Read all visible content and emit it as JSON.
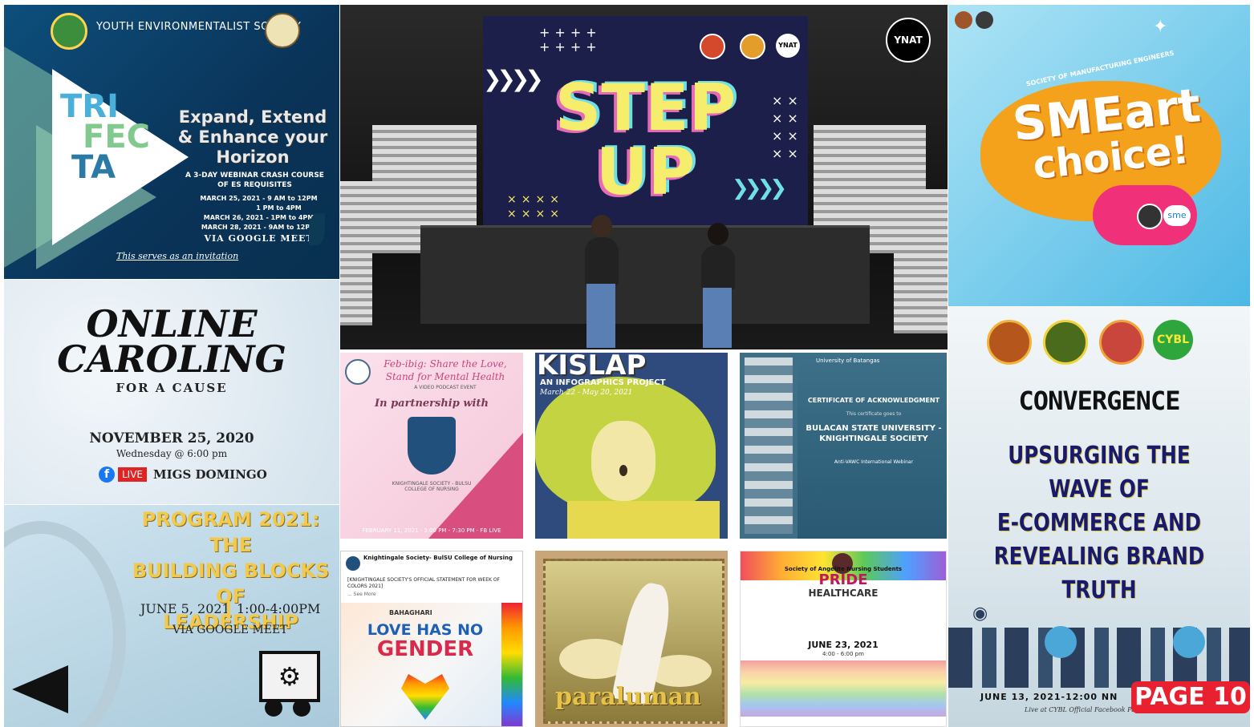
{
  "trifecta": {
    "org": "YOUTH ENVIRONMENTALIST SOCIETY",
    "logo_lines": [
      "TRI",
      "FEC",
      "TA"
    ],
    "headline_1": "Expand, Extend",
    "headline_2": "& Enhance your",
    "headline_3": "Horizon",
    "sub_1": "A 3-DAY WEBINAR CRASH COURSE",
    "sub_2": "OF ES REQUISITES",
    "dates": [
      "MARCH 25, 2021 - 9 AM to 12PM",
      "1 PM to 4PM",
      "MARCH 26, 2021 - 1PM to 4PM",
      "MARCH 28, 2021 - 9AM to 12PM"
    ],
    "via": "VIA GOOGLE MEET",
    "invite": "This serves as an invitation"
  },
  "stepup": {
    "line_1": "STEP",
    "line_2": "UP",
    "badge": "YNAT",
    "corner_badge": "YNAT"
  },
  "smeart": {
    "arc_text": "SOCIETY OF MANUFACTURING ENGINEERS",
    "line_1": "SMEart",
    "line_2": "choice!",
    "badge": "sme"
  },
  "caroling": {
    "line_1": "ONLINE",
    "line_2": "CAROLING",
    "line_3": "FOR A CAUSE",
    "date": "NOVEMBER 25, 2020",
    "time": "Wednesday @ 6:00 pm",
    "live": "LIVE",
    "host": "MIGS DOMINGO"
  },
  "program": {
    "line_1": "PROGRAM 2021: THE",
    "line_2": "BUILDING BLOCKS OF",
    "line_3": "LEADERSHIP",
    "date": "JUNE 5, 2021",
    "time": "1:00-4:00PM",
    "via": "VIA GOOGLE MEET"
  },
  "febibig": {
    "title_1": "Feb-ibig: Share the Love,",
    "title_2": "Stand for Mental Health",
    "sub": "A VIDEO PODCAST EVENT",
    "partner": "In partnership with",
    "org": "KNIGHTINGALE SOCIETY - BULSU",
    "college": "COLLEGE OF NURSING",
    "footer": "FEBRUARY 11, 2021 · 3:00 PM - 7:30 PM · FB LIVE"
  },
  "kislap": {
    "title": "KISLAP",
    "sub": "AN INFOGRAPHICS PROJECT",
    "dates": "March 22 - May 20, 2021"
  },
  "certificate": {
    "univ": "University of Batangas",
    "title": "CERTIFICATE OF ACKNOWLEDGMENT",
    "given": "This certificate goes to",
    "name_1": "BULACAN STATE UNIVERSITY -",
    "name_2": "KNIGHTINGALE SOCIETY",
    "webinar": "Anti-VAWC International Webinar"
  },
  "statement": {
    "org": "Knightingale Society- BulSU College of Nursing",
    "post": "[KNIGHTINGALE SOCIETY'S OFFICIAL STATEMENT FOR WEEK OF COLORS 2021]",
    "more": "... See More",
    "brand": "BAHAGHARI",
    "line_1": "LOVE HAS NO",
    "line_2": "GENDER"
  },
  "paraluman": {
    "title": "paraluman"
  },
  "pride": {
    "org": "Society of Angelite Nursing Students",
    "title_1": "PRIDE",
    "title_2": "HEALTHCARE",
    "date": "JUNE 23, 2021",
    "time": "4:00 - 6:00 pm"
  },
  "convergence": {
    "badge": "CYBL",
    "title": "CONVERGENCE",
    "line_1": "UPSURGING THE",
    "line_2": "WAVE OF",
    "line_3": "E-COMMERCE AND",
    "line_4": "REVEALING BRAND",
    "line_5": "TRUTH",
    "date": "JUNE 13, 2021-12:00 NN",
    "live": "Live at CYBL Official Facebook Page"
  },
  "page_label": "PAGE 10"
}
